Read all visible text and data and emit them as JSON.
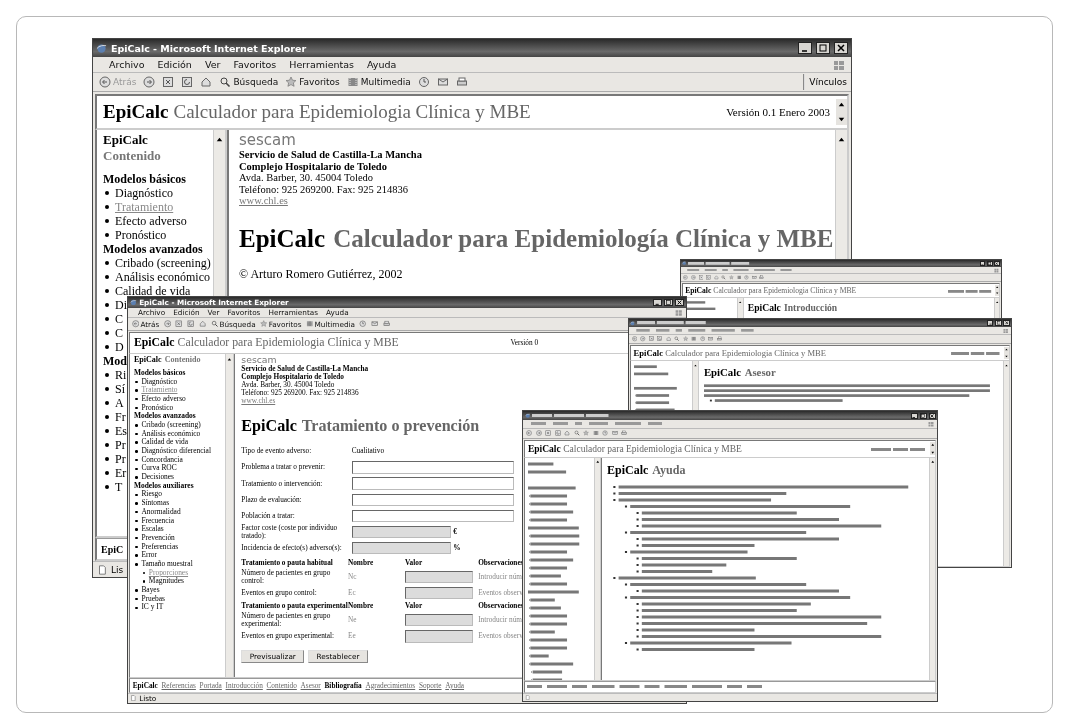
{
  "windows": [
    {
      "kind": "home",
      "title": "EpiCalc - Microsoft Internet Explorer",
      "menu": [
        "Archivo",
        "Edición",
        "Ver",
        "Favoritos",
        "Herramientas",
        "Ayuda"
      ],
      "toolbar": [
        {
          "kind": "back",
          "label": "Atrás",
          "disabled": true
        },
        {
          "kind": "search",
          "label": "Búsqueda",
          "disabled": false
        },
        {
          "kind": "favorites",
          "label": "Favoritos",
          "disabled": false
        },
        {
          "kind": "media",
          "label": "Multimedia",
          "disabled": false
        }
      ],
      "links": "Vínculos",
      "header": {
        "brand": "EpiCalc",
        "subtitle": "Calculador para Epidemiologia Clínica y MBE",
        "version": "Versión 0.1 Enero 2003"
      },
      "sidebar": {
        "brand": "EpiCalc",
        "label": "Contenido",
        "sections": [
          {
            "heading": "Modelos básicos",
            "items": [
              {
                "label": "Diagnóstico",
                "visited": false
              },
              {
                "label": "Tratamiento",
                "visited": true
              },
              {
                "label": "Efecto adverso",
                "visited": false
              },
              {
                "label": "Pronóstico",
                "visited": false
              }
            ]
          },
          {
            "heading": "Modelos avanzados",
            "items": [
              {
                "label": "Cribado (screening)",
                "visited": false
              },
              {
                "label": "Análisis económico",
                "visited": false
              },
              {
                "label": "Calidad de vida",
                "visited": false
              },
              {
                "label": "Di",
                "visited": false
              },
              {
                "label": "C",
                "visited": false
              },
              {
                "label": "C",
                "visited": false
              },
              {
                "label": "D",
                "visited": false
              }
            ]
          },
          {
            "heading": "Mod",
            "items": [
              {
                "label": "Ri",
                "visited": false
              },
              {
                "label": "Sí",
                "visited": false
              },
              {
                "label": "A",
                "visited": false
              },
              {
                "label": "Fr",
                "visited": false
              },
              {
                "label": "Es",
                "visited": false
              },
              {
                "label": "Pr",
                "visited": false
              },
              {
                "label": "Pr",
                "visited": false
              },
              {
                "label": "Er",
                "visited": false
              },
              {
                "label": "T",
                "visited": false
              }
            ]
          }
        ]
      },
      "content": {
        "org": {
          "logo": "sescam",
          "lines": [
            {
              "text": "Servicio de Salud de Castilla-La Mancha",
              "kind": "bold"
            },
            {
              "text": "Complejo Hospitalario de Toledo",
              "kind": "bold"
            },
            {
              "text": "Avda. Barber, 30. 45004 Toledo",
              "kind": "plain"
            },
            {
              "text": "Teléfono: 925 269200. Fax: 925 214836",
              "kind": "plain"
            },
            {
              "text": "www.chl.es",
              "kind": "link"
            }
          ]
        },
        "heading": {
          "brand": "EpiCalc",
          "text": "Calculador para Epidemiología Clínica y MBE"
        },
        "copyright": "© Arturo Romero Gutiérrez, 2002"
      },
      "footer": [
        {
          "label": "EpiC",
          "kind": "brand"
        }
      ],
      "status": "Lis"
    },
    {
      "kind": "intro",
      "header": {
        "brand": "EpiCalc",
        "subtitle": "Calculador para Epidemiologia Clínica y MBE"
      },
      "content": {
        "heading": {
          "brand": "EpiCalc",
          "text": "Introducción"
        }
      }
    },
    {
      "kind": "form",
      "title": "EpiCalc - Microsoft Internet Explorer",
      "menu": [
        "Archivo",
        "Edición",
        "Ver",
        "Favoritos",
        "Herramientas",
        "Ayuda"
      ],
      "toolbar": [
        {
          "kind": "back",
          "label": "Atrás",
          "disabled": false
        },
        {
          "kind": "search",
          "label": "Búsqueda",
          "disabled": false
        },
        {
          "kind": "favorites",
          "label": "Favoritos",
          "disabled": false
        },
        {
          "kind": "media",
          "label": "Multimedia",
          "disabled": false
        }
      ],
      "header": {
        "brand": "EpiCalc",
        "subtitle": "Calculador para Epidemiologia Clínica y MBE",
        "version": "Versión 0"
      },
      "sidebar": {
        "brand": "EpiCalc",
        "label": "Contenido",
        "sections": [
          {
            "heading": "Modelos básicos",
            "items": [
              {
                "label": "Diagnóstico",
                "visited": false
              },
              {
                "label": "Tratamiento",
                "visited": true
              },
              {
                "label": "Efecto adverso",
                "visited": false
              },
              {
                "label": "Pronóstico",
                "visited": false
              }
            ]
          },
          {
            "heading": "Modelos avanzados",
            "items": [
              {
                "label": "Cribado (screening)",
                "visited": false
              },
              {
                "label": "Análisis económico",
                "visited": false
              },
              {
                "label": "Calidad de vida",
                "visited": false
              },
              {
                "label": "Diagnóstico diferencial",
                "visited": false
              },
              {
                "label": "Concordancia",
                "visited": false
              },
              {
                "label": "Curva ROC",
                "visited": false
              },
              {
                "label": "Decisiones",
                "visited": false
              }
            ]
          },
          {
            "heading": "Modelos auxiliares",
            "items": [
              {
                "label": "Riesgo",
                "visited": false
              },
              {
                "label": "Síntomas",
                "visited": false
              },
              {
                "label": "Anormalidad",
                "visited": false
              },
              {
                "label": "Frecuencia",
                "visited": false
              },
              {
                "label": "Escalas",
                "visited": false
              },
              {
                "label": "Prevención",
                "visited": false
              },
              {
                "label": "Preferencias",
                "visited": false
              },
              {
                "label": "Error",
                "visited": false
              },
              {
                "label": "Tamaño muestral",
                "visited": false,
                "children": [
                  {
                    "label": "Proporciones",
                    "visited": true
                  },
                  {
                    "label": "Magnitudes",
                    "visited": false
                  }
                ]
              },
              {
                "label": "Bayes",
                "visited": false
              },
              {
                "label": "Pruebas",
                "visited": false
              },
              {
                "label": "IC y IT",
                "visited": false
              }
            ]
          }
        ]
      },
      "content": {
        "org": {
          "logo": "sescam",
          "lines": [
            {
              "text": "Servicio de Salud de Castilla-La Mancha",
              "kind": "bold"
            },
            {
              "text": "Complejo Hospitalario de Toledo",
              "kind": "bold"
            },
            {
              "text": "Avda. Barber, 30. 45004 Toledo",
              "kind": "plain"
            },
            {
              "text": "Teléfono: 925 269200. Fax: 925 214836",
              "kind": "plain"
            },
            {
              "text": "www.chl.es",
              "kind": "link"
            }
          ]
        },
        "heading": {
          "brand": "EpiCalc",
          "text": "Tratamiento o prevención"
        },
        "fields": [
          {
            "label": "Tipo de evento adverso:",
            "kind": "value",
            "value": "Cualitativo"
          },
          {
            "label": "Problema a tratar o prevenir:",
            "kind": "wide",
            "disabled": false
          },
          {
            "label": "Tratamiento o intervención:",
            "kind": "wide",
            "disabled": false
          },
          {
            "label": "Plazo de evaluación:",
            "kind": "wide",
            "disabled": false
          },
          {
            "label": "Población a tratar:",
            "kind": "wide",
            "disabled": false
          },
          {
            "label": "Factor coste (coste por individuo tratado):",
            "kind": "short",
            "disabled": true,
            "unit": "€"
          },
          {
            "label": "Incidencia de efecto(s) adverso(s):",
            "kind": "short",
            "disabled": true,
            "unit": "%"
          }
        ],
        "tables": [
          {
            "columns": [
              "Tratamiento o pauta habitual",
              "Nombre",
              "Valor",
              "Observaciones"
            ],
            "rows": [
              {
                "label": "Número de pacientes en grupo control:",
                "name": "Nc",
                "observation": "Introducir núm"
              },
              {
                "label": "Eventos en grupo control:",
                "name": "Ec",
                "observation": "Eventos observ"
              }
            ]
          },
          {
            "columns": [
              "Tratamiento o pauta experimental",
              "Nombre",
              "Valor",
              "Observaciones"
            ],
            "rows": [
              {
                "label": "Número de pacientes en grupo experimental:",
                "name": "Ne",
                "observation": "Introducir núm"
              },
              {
                "label": "Eventos en grupo experimental:",
                "name": "Ee",
                "observation": "Eventos observ"
              }
            ]
          }
        ],
        "buttons": [
          "Previsualizar",
          "Restablecer"
        ]
      },
      "footer": [
        {
          "label": "EpiCalc",
          "kind": "brand"
        },
        {
          "label": "Referencias",
          "kind": "link"
        },
        {
          "label": "Portada",
          "kind": "link"
        },
        {
          "label": "Introducción",
          "kind": "link"
        },
        {
          "label": "Contenido",
          "kind": "link"
        },
        {
          "label": "Asesor",
          "kind": "link"
        },
        {
          "label": "Bibliografía",
          "kind": "brand"
        },
        {
          "label": "Agradecimientos",
          "kind": "link"
        },
        {
          "label": "Soporte",
          "kind": "link"
        },
        {
          "label": "Ayuda",
          "kind": "link"
        }
      ],
      "status": "Listo"
    },
    {
      "kind": "advisor",
      "header": {
        "brand": "EpiCalc",
        "subtitle": "Calculador para Epidemiologia Clínica y MBE"
      },
      "content": {
        "heading": {
          "brand": "EpiCalc",
          "text": "Asesor"
        }
      }
    },
    {
      "kind": "help",
      "header": {
        "brand": "EpiCalc",
        "subtitle": "Calculador para Epidemiologia Clínica y MBE"
      },
      "content": {
        "heading": {
          "brand": "EpiCalc",
          "text": "Ayuda"
        }
      }
    }
  ]
}
